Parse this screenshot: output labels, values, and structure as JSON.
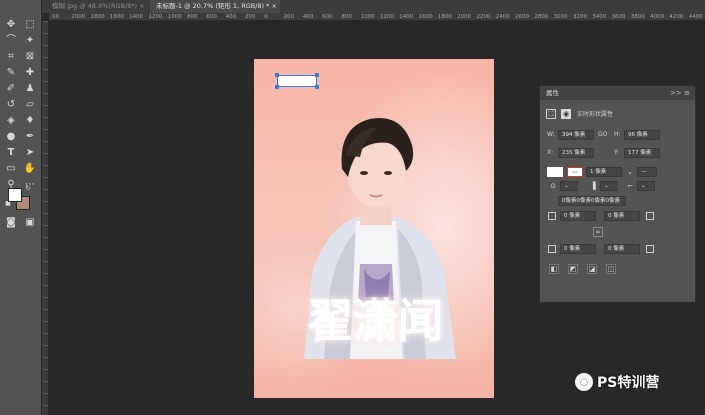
{
  "tabs": [
    {
      "label": "模糊.jpg @ 48.8%(RGB/8*) ×"
    },
    {
      "label": "未标题-1 @ 20.7% (矩形 1, RGB/8) * ×"
    }
  ],
  "ruler": {
    "h_ticks": [
      "00",
      "2000",
      "1800",
      "1600",
      "1400",
      "1200",
      "1000",
      "800",
      "600",
      "400",
      "200",
      "0",
      "200",
      "400",
      "600",
      "800",
      "1000",
      "1200",
      "1400",
      "1600",
      "1800",
      "2000",
      "2200",
      "2400",
      "2600",
      "2800",
      "3000",
      "3200",
      "3400",
      "3600",
      "3800",
      "4000",
      "4200",
      "4400"
    ]
  },
  "poster": {
    "title": "翟潇闻"
  },
  "properties": {
    "header": "属性",
    "collapse_glyph": ">> ≡",
    "section_title": "实时形状属性",
    "w_label": "W:",
    "w_value": "394 像素",
    "link_glyph": "GO",
    "h_label": "H:",
    "h_value": "96 像素",
    "x_label": "X:",
    "x_value": "235 像素",
    "y_label": "Y:",
    "y_value": "177 像素",
    "stroke_width": "1 像素",
    "corner_radii_all": "0像素0像素0像素0像素",
    "corner_top_left": "0 像素",
    "corner_top_right": "0 像素",
    "corner_bottom_left": "0 像素",
    "corner_bottom_right": "0 像素"
  },
  "watermark": {
    "text": "PS特训营"
  },
  "colors": {
    "foreground": "#ffffff",
    "background": "#b08a78",
    "selection": "#3a7bd5",
    "poster_pink": "#f7b6a8"
  }
}
